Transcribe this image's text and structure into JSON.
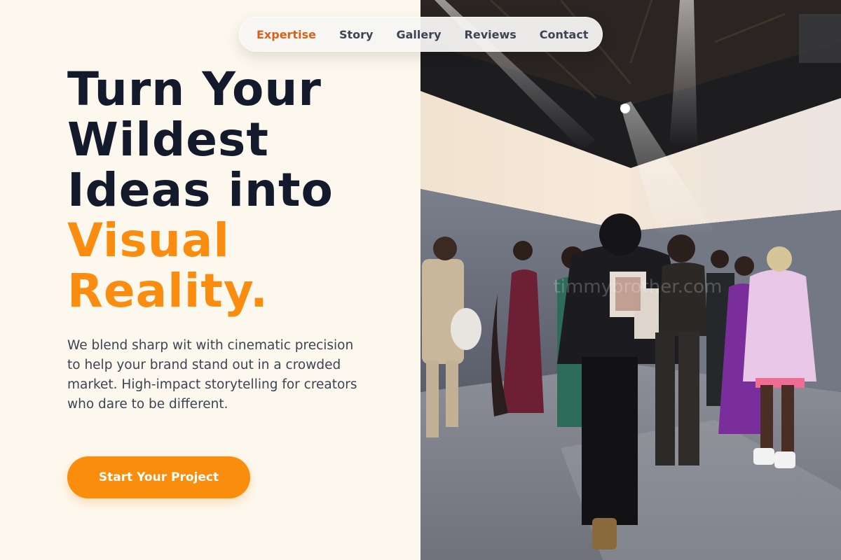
{
  "nav": {
    "items": [
      {
        "label": "Expertise",
        "active": true
      },
      {
        "label": "Story",
        "active": false
      },
      {
        "label": "Gallery",
        "active": false
      },
      {
        "label": "Reviews",
        "active": false
      },
      {
        "label": "Contact",
        "active": false
      }
    ]
  },
  "hero": {
    "title_lines": [
      "Turn Your",
      "Wildest",
      "Ideas into"
    ],
    "title_accent_lines": [
      "Visual",
      "Reality."
    ],
    "subtitle": "We blend sharp wit with cinematic precision to help your brand stand out in a crowded market. High-impact storytelling for creators who dare to be different.",
    "cta_label": "Start Your Project"
  },
  "photo": {
    "watermark": "timmybrother.com"
  },
  "colors": {
    "background": "#fdf8ee",
    "heading": "#131a2b",
    "accent": "#fa8c0f",
    "nav_active": "#d9621a",
    "body_text": "#3b4354"
  }
}
